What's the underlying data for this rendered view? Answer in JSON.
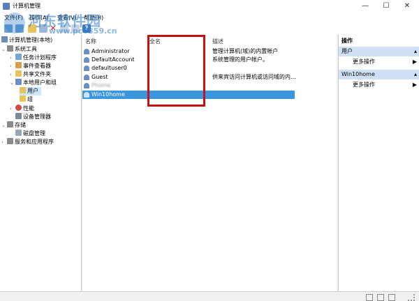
{
  "window": {
    "title": "计算机管理",
    "controls": {
      "minimize": "—",
      "maximize": "☐",
      "close": "✕"
    }
  },
  "menu": {
    "items": [
      "文件(F)",
      "操作(A)",
      "查看(V)",
      "帮助(H)"
    ]
  },
  "watermark": {
    "line1": "河东软件园",
    "line2": "www.pc0359.cn"
  },
  "tree": {
    "root": "计算机管理(本地)",
    "items": [
      {
        "label": "系统工具",
        "level": 0,
        "expanded": true
      },
      {
        "label": "任务计划程序",
        "level": 1
      },
      {
        "label": "事件查看器",
        "level": 1
      },
      {
        "label": "共享文件夹",
        "level": 1
      },
      {
        "label": "本地用户和组",
        "level": 1,
        "expanded": true
      },
      {
        "label": "用户",
        "level": 2,
        "selected": true
      },
      {
        "label": "组",
        "level": 2
      },
      {
        "label": "性能",
        "level": 1
      },
      {
        "label": "设备管理器",
        "level": 1
      },
      {
        "label": "存储",
        "level": 0,
        "expanded": true
      },
      {
        "label": "磁盘管理",
        "level": 1
      },
      {
        "label": "服务和应用程序",
        "level": 0
      }
    ]
  },
  "list": {
    "columns": {
      "name": "名称",
      "fullname": "全名",
      "description": "描述"
    },
    "rows": [
      {
        "name": "Administrator",
        "fullname": "",
        "description": "管理计算机(域)的内置帐户"
      },
      {
        "name": "DefaultAccount",
        "fullname": "",
        "description": "系统管理的用户帐户。"
      },
      {
        "name": "defaultuser0",
        "fullname": "",
        "description": ""
      },
      {
        "name": "Guest",
        "fullname": "",
        "description": "供来宾访问计算机或访问域的内..."
      },
      {
        "name": "Phome",
        "fullname": "",
        "description": ""
      },
      {
        "name": "Win10home",
        "fullname": "",
        "description": ""
      }
    ]
  },
  "actions": {
    "title": "操作",
    "section1": {
      "title": "用户",
      "more": "更多操作"
    },
    "section2": {
      "title": "Win10home",
      "more": "更多操作"
    }
  }
}
